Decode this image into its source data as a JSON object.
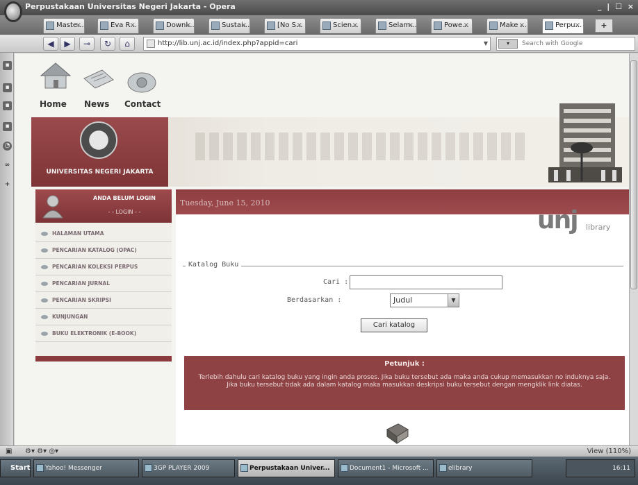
{
  "window": {
    "title": "Perpustakaan Universitas Negeri Jakarta - Opera",
    "controls": "_ | ☐ ×"
  },
  "tabs": [
    {
      "label": "Maste..."
    },
    {
      "label": "Eva R..."
    },
    {
      "label": "Downl..."
    },
    {
      "label": "Sustai..."
    },
    {
      "label": "[No S..."
    },
    {
      "label": "Scien..."
    },
    {
      "label": "Selam..."
    },
    {
      "label": "Powe..."
    },
    {
      "label": "Make ..."
    },
    {
      "label": "Perpu..."
    }
  ],
  "address": {
    "url": "http://lib.unj.ac.id/index.php?appid=cari",
    "search_placeholder": "Search with Google"
  },
  "site": {
    "nav": {
      "home": "Home",
      "news": "News",
      "contact": "Contact"
    },
    "university": "UNIVERSITAS NEGERI JAKARTA",
    "login_status": "ANDA BELUM LOGIN",
    "login_link": "- - LOGIN - -",
    "menu": [
      "HALAMAN UTAMA",
      "PENCARIAN KATALOG (OPAC)",
      "PENCARIAN KOLEKSI PERPUS",
      "PENCARIAN JURNAL",
      "PENCARIAN SKRIPSI",
      "KUNJUNGAN",
      "BUKU ELEKTRONIK (E-BOOK)"
    ],
    "date": "Tuesday, June 15, 2010",
    "logo_text": "unj",
    "logo_sub": "library",
    "form": {
      "legend": "Katalog Buku",
      "cari_label": "Cari :",
      "cari_value": "",
      "berdasarkan_label": "Berdasarkan :",
      "berdasarkan_value": "Judul",
      "submit": "Cari katalog"
    },
    "petunjuk": {
      "title": "Petunjuk :",
      "body": "Terlebih dahulu cari katalog buku yang ingin anda proses. Jika buku tersebut ada maka anda cukup memasukkan no induknya saja. Jika buku tersebut tidak ada dalam katalog maka masukkan deskripsi buku tersebut dengan mengklik link diatas."
    }
  },
  "statusbar": {
    "zoom": "View (110%)"
  },
  "taskbar": {
    "start": "Start",
    "items": [
      {
        "label": "Yahoo! Messenger",
        "active": false
      },
      {
        "label": "3GP PLAYER 2009",
        "active": false
      },
      {
        "label": "Perpustakaan Univer...",
        "active": true
      },
      {
        "label": "Document1 - Microsoft ...",
        "active": false
      },
      {
        "label": "elibrary",
        "active": false
      }
    ],
    "clock": "16:11"
  },
  "colors": {
    "maroon": "#8f4244",
    "page_bg": "#f4f4f0"
  }
}
